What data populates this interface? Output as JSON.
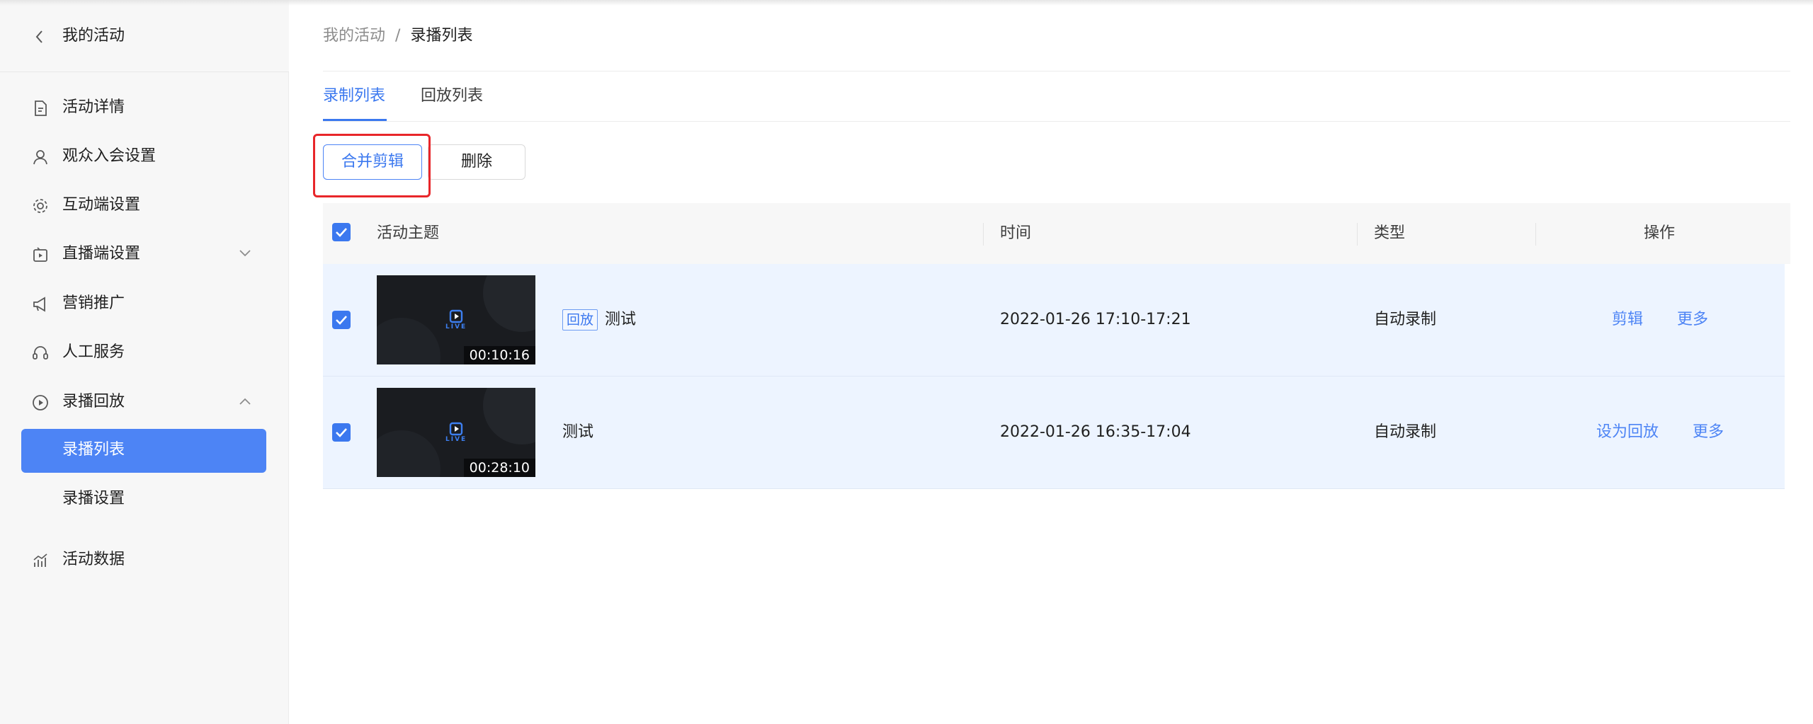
{
  "sidebar": {
    "back_title": "我的活动",
    "items": [
      {
        "label": "活动详情",
        "icon": "document-icon"
      },
      {
        "label": "观众入会设置",
        "icon": "user-icon"
      },
      {
        "label": "互动端设置",
        "icon": "settings-icon"
      },
      {
        "label": "直播端设置",
        "icon": "live-screen-icon",
        "expand": "chevron-down-icon"
      },
      {
        "label": "营销推广",
        "icon": "megaphone-icon"
      },
      {
        "label": "人工服务",
        "icon": "headset-icon"
      },
      {
        "label": "录播回放",
        "icon": "play-circle-icon",
        "expand": "chevron-up-icon"
      },
      {
        "label": "活动数据",
        "icon": "bar-chart-icon"
      }
    ],
    "subitems": [
      {
        "label": "录播列表",
        "active": true
      },
      {
        "label": "录播设置",
        "active": false
      }
    ]
  },
  "breadcrumb": {
    "parent": "我的活动",
    "separator": "/",
    "current": "录播列表"
  },
  "tabs": [
    {
      "label": "录制列表",
      "active": true
    },
    {
      "label": "回放列表",
      "active": false
    }
  ],
  "toolbar": {
    "merge_label": "合并剪辑",
    "delete_label": "删除"
  },
  "table": {
    "headers": {
      "topic": "活动主题",
      "time": "时间",
      "type": "类型",
      "action": "操作"
    },
    "rows": [
      {
        "duration": "00:10:16",
        "tag": "回放",
        "title": "测试",
        "time": "2022-01-26 17:10-17:21",
        "type": "自动录制",
        "action1": "剪辑",
        "action2": "更多",
        "checked": true
      },
      {
        "duration": "00:28:10",
        "tag": "",
        "title": "测试",
        "time": "2022-01-26 16:35-17:04",
        "type": "自动录制",
        "action1": "设为回放",
        "action2": "更多",
        "checked": true
      }
    ]
  },
  "thumbnail": {
    "brand_text": "LIVE"
  },
  "colors": {
    "accent": "#3b78ef",
    "active_nav_bg": "#4d84f5",
    "row_bg": "#edf4ff",
    "highlight": "#e8262a"
  }
}
